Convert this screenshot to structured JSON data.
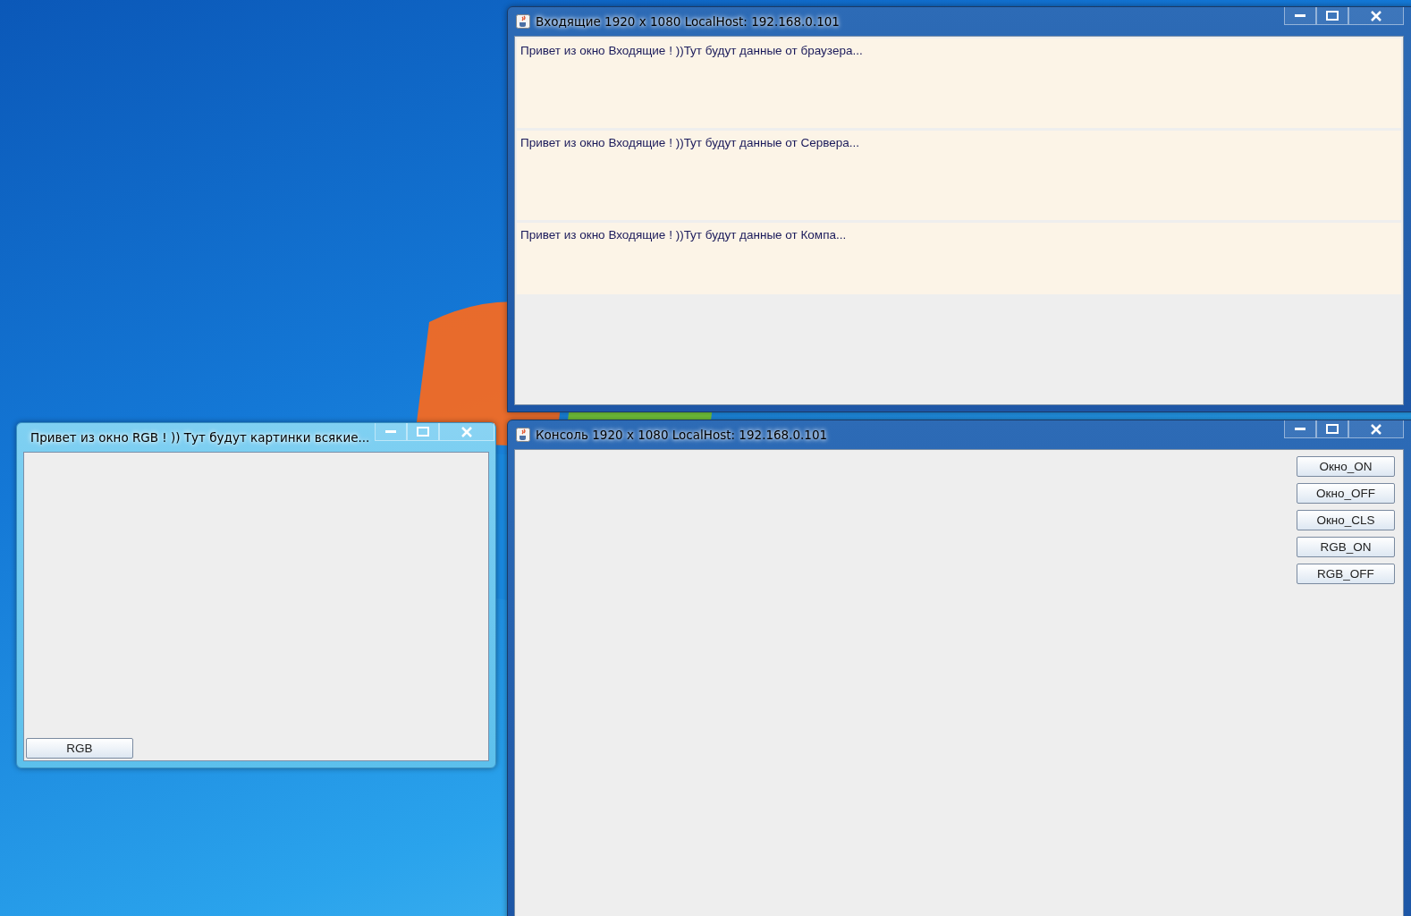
{
  "windows": [
    {
      "kind": "messages",
      "title": "Входящие 1920 x 1080 LocalHost: 192.168.0.101",
      "messages": [
        "Привет из окно Входящие ! ))Тут будут данные от браузера...",
        "Привет из окно Входящие ! ))Тут будут данные от Сервера...",
        "Привет из окно Входящие ! ))Тут будут данные от Компа..."
      ]
    },
    {
      "kind": "canvas",
      "title": "Привет из окно RGB ! )) Тут будут картинки всякие...",
      "buttons": [
        "RGB"
      ]
    },
    {
      "kind": "console",
      "title": "Консоль 1920 x 1080 LocalHost: 192.168.0.101",
      "buttons": [
        "Окно_ON",
        "Окно_OFF",
        "Окно_CLS",
        "RGB_ON",
        "RGB_OFF"
      ]
    }
  ]
}
